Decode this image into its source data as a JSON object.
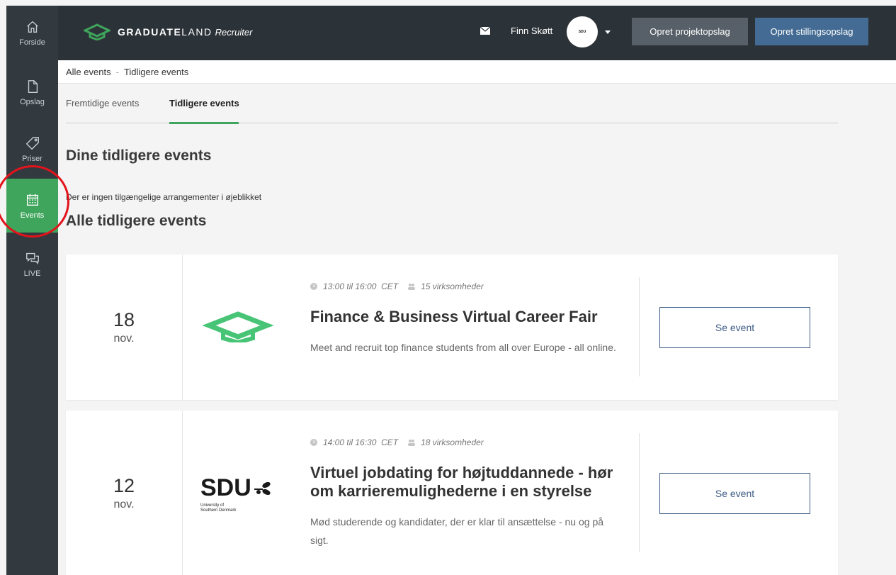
{
  "sidebar": {
    "items": [
      {
        "label": "Forside",
        "icon": "home-icon"
      },
      {
        "label": "Opslag",
        "icon": "document-icon"
      },
      {
        "label": "Priser",
        "icon": "tag-icon"
      },
      {
        "label": "Events",
        "icon": "calendar-icon",
        "active": true
      },
      {
        "label": "LIVE",
        "icon": "chat-bubbles-icon"
      }
    ]
  },
  "header": {
    "logo_bold": "GRADUATE",
    "logo_light": "LAND",
    "logo_sub": "Recruiter",
    "user_name": "Finn Skøtt",
    "avatar_text": "SDU",
    "create_project_label": "Opret projektopslag",
    "create_job_label": "Opret stillingsopslag"
  },
  "breadcrumb": {
    "root": "Alle events",
    "separator": "-",
    "current": "Tidligere events"
  },
  "tabs": [
    {
      "label": "Fremtidige events"
    },
    {
      "label": "Tidligere events",
      "active": true
    }
  ],
  "sections": {
    "my_past_title": "Dine tidligere events",
    "empty_note": "Der er ingen tilgængelige arrangementer i øjeblikket",
    "all_past_title": "Alle tidligere events"
  },
  "events": [
    {
      "day": "18",
      "month": "nov.",
      "time": "13:00 til 16:00",
      "timezone": "CET",
      "companies": "15 virksomheder",
      "title": "Finance & Business Virtual Career Fair",
      "description": "Meet and recruit top finance students from all over Europe - all online.",
      "button_label": "Se event"
    },
    {
      "day": "12",
      "month": "nov.",
      "time": "14:00 til 16:30",
      "timezone": "CET",
      "companies": "18 virksomheder",
      "title": "Virtuel jobdating for højtuddannede - hør om karrieremulighederne i en styrelse",
      "description": "Mød studerende og kandidater, der er klar til ansættelse - nu og på sigt.",
      "button_label": "Se event",
      "logo_text": "SDU",
      "logo_sub_1": "University of",
      "logo_sub_2": "Southern Denmark"
    }
  ],
  "colors": {
    "accent_green": "#3fa55c",
    "sidebar_bg": "#333a3f",
    "topbar_bg": "#2c3338",
    "button_blue": "#436b93",
    "highlight_red": "#e3131b"
  }
}
